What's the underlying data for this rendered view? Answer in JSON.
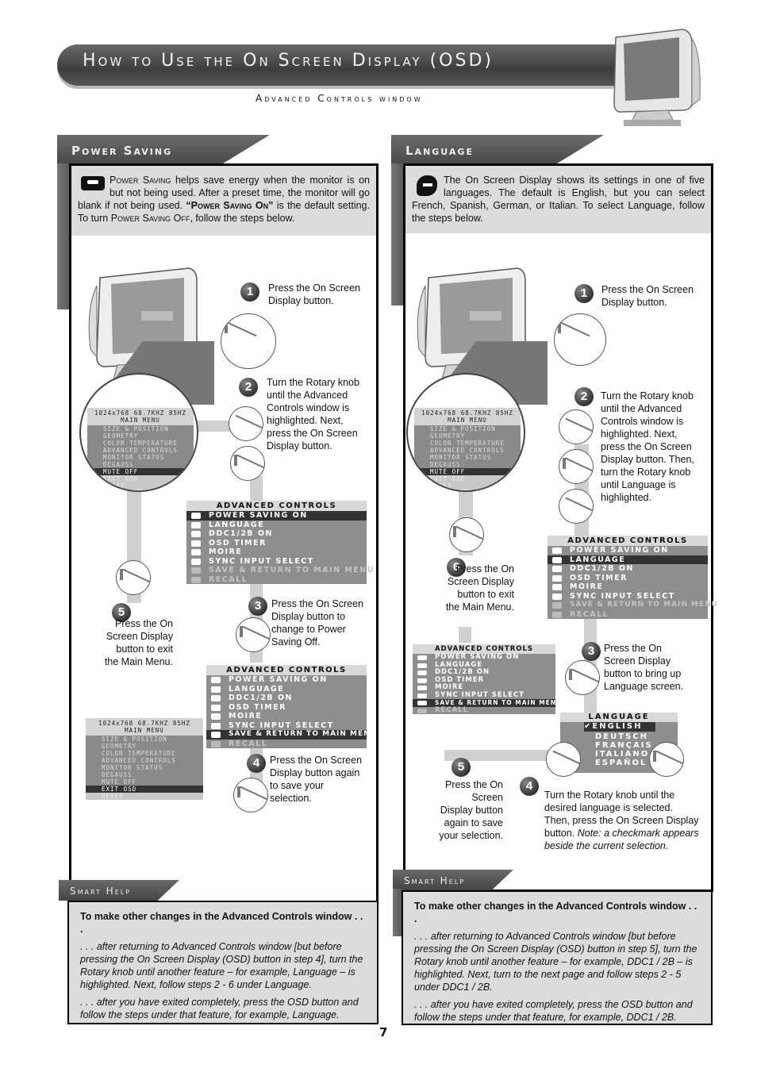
{
  "header": {
    "title": "How to Use the On Screen Display (OSD)",
    "subtitle": "Advanced Controls window"
  },
  "power_saving": {
    "tab_label": "Power Saving",
    "intro_parts": [
      "Power Saving",
      " helps save energy when the monitor is on but not being used. After a preset time, the monitor will go blank if not being used. ",
      "“Power Saving On”",
      " is the default setting. To turn ",
      "Power Saving Off",
      ", follow the steps below."
    ],
    "steps": [
      {
        "num": "1",
        "text": "Press the On Screen Display button."
      },
      {
        "num": "2",
        "text": "Turn the Rotary knob until the Advanced Controls window is highlighted. Next, press the On Screen Display button."
      },
      {
        "num": "3",
        "text": "Press the On Screen Display button to change to Power Saving Off."
      },
      {
        "num": "4",
        "text": "Press the On Screen Display button again to save your selection."
      },
      {
        "num": "5",
        "text": "Press the On Screen Display button to exit the Main Menu."
      }
    ],
    "osd_a": {
      "title": "ADVANCED CONTROLS",
      "items": [
        "POWER SAVING ON",
        "LANGUAGE",
        "DDC1/2B ON",
        "OSD TIMER",
        "MOIRE",
        "SYNC INPUT SELECT",
        "SAVE & RETURN TO MAIN MENU",
        "RECALL"
      ],
      "selected": "POWER SAVING ON"
    },
    "osd_b": {
      "title": "ADVANCED CONTROLS",
      "items": [
        "POWER SAVING ON",
        "LANGUAGE",
        "DDC1/2B ON",
        "OSD TIMER",
        "MOIRE",
        "SYNC INPUT SELECT",
        "SAVE & RETURN TO MAIN MENU",
        "RECALL"
      ],
      "selected": "SAVE & RETURN TO MAIN MENU"
    },
    "main_menu_top": {
      "status": "1024x768  68.7KHZ 85HZ",
      "title": "MAIN MENU",
      "items": [
        "SIZE & POSITION",
        "GEOMETRY",
        "COLOR TEMPERATURE",
        "ADVANCED CONTROLS",
        "MONITOR STATUS",
        "DEGAUSS",
        "MUTE OFF",
        "EXIT OSD",
        "RESET"
      ],
      "selected": "MUTE OFF"
    },
    "main_menu_bottom": {
      "status": "1024x768  68.7KHZ 85HZ",
      "title": "MAIN MENU",
      "items": [
        "SIZE & POSITION",
        "GEOMETRY",
        "COLOR TEMPERATURE",
        "ADVANCED CONTROLS",
        "MONITOR STATUS",
        "DEGAUSS",
        "MUTE OFF",
        "EXIT OSD",
        "RESET"
      ],
      "selected": "EXIT OSD"
    },
    "smart_help": {
      "tab_label": "Smart Help",
      "heading": "To make other changes in the Advanced Controls window . . .",
      "para1": ". . . after returning to Advanced Controls window [but before pressing the On Screen Display (OSD) button in step 4], turn the Rotary knob until another feature – for example, Language – is highlighted. Next, follow steps 2 - 6 under Language.",
      "para2": ". . . after you have exited completely, press the OSD button and follow the steps under that feature, for example, Language."
    }
  },
  "language": {
    "tab_label": "Language",
    "intro": "The On Screen Display shows its settings in one of five languages. The default is English, but you can select French, Spanish, German, or Italian. To select Language, follow the steps below.",
    "steps": [
      {
        "num": "1",
        "text": "Press the On Screen Display button."
      },
      {
        "num": "2",
        "text": "Turn the Rotary knob until the Advanced Controls window is highlighted. Next, press the On Screen Display button. Then, turn the Rotary knob until Language is highlighted."
      },
      {
        "num": "3",
        "text": "Press the On Screen Display button to bring up Language screen."
      },
      {
        "num": "4",
        "text": "Turn the Rotary knob until the desired language is selected. Then, press the On Screen Display button.",
        "note": "Note: a checkmark appears beside the current selection."
      },
      {
        "num": "5",
        "text": "Press the On Screen Display button again to save your selection."
      },
      {
        "num": "6",
        "text": "Press the On Screen Display button to exit the Main Menu."
      }
    ],
    "osd_a": {
      "title": "ADVANCED CONTROLS",
      "items": [
        "POWER SAVING ON",
        "LANGUAGE",
        "DDC1/2B ON",
        "OSD TIMER",
        "MOIRE",
        "SYNC INPUT SELECT",
        "SAVE & RETURN TO MAIN MENU",
        "RECALL"
      ],
      "selected": "LANGUAGE"
    },
    "osd_b": {
      "title": "ADVANCED CONTROLS",
      "items": [
        "POWER SAVING ON",
        "LANGUAGE",
        "DDC1/2B ON",
        "OSD TIMER",
        "MOIRE",
        "SYNC INPUT SELECT",
        "SAVE & RETURN TO MAIN MENU",
        "RECALL"
      ],
      "selected": "SAVE & RETURN TO MAIN MENU"
    },
    "main_menu": {
      "status": "1024x768  68.7KHZ 85HZ",
      "title": "MAIN MENU",
      "items": [
        "SIZE & POSITION",
        "GEOMETRY",
        "COLOR TEMPERATURE",
        "ADVANCED CONTROLS",
        "MONITOR STATUS",
        "DEGAUSS",
        "MUTE OFF",
        "EXIT OSD",
        "RESET"
      ],
      "selected": "MUTE OFF"
    },
    "language_screen": {
      "title": "LANGUAGE",
      "options": [
        "ENGLISH",
        "DEUTSCH",
        "FRANÇAIS",
        "ITALIANO",
        "ESPAÑOL"
      ],
      "selected": "ENGLISH",
      "check": "✔"
    },
    "smart_help": {
      "tab_label": "Smart Help",
      "heading": "To make other changes in the Advanced Controls window . . .",
      "para1": ". . . after returning to Advanced Controls window [but before pressing the On Screen Display (OSD) button in step 5], turn the Rotary knob until another feature – for example, DDC1 / 2B – is highlighted. Next, turn to the next page and follow steps 2 - 5 under DDC1 / 2B.",
      "para2": ". . . after you have exited completely, press the OSD button and follow the steps under that feature, for example, DDC1 / 2B."
    }
  },
  "page_number": "7"
}
